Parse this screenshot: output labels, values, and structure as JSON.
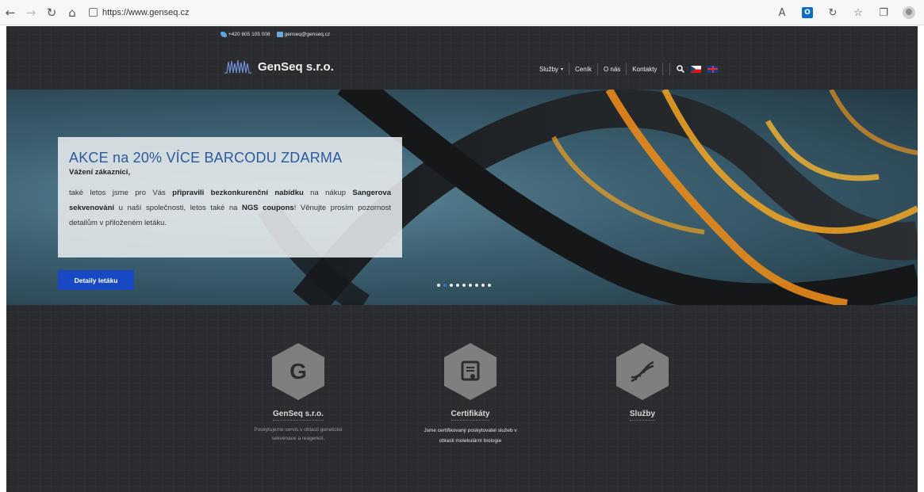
{
  "browser": {
    "url": "https://www.genseq.cz"
  },
  "topbar": {
    "phone": "+420 605 105 008",
    "email": "genseq@genseq.cz"
  },
  "header": {
    "logo_text": "GenSeq s.r.o.",
    "menu": [
      {
        "label": "Služby"
      },
      {
        "label": "Ceník"
      },
      {
        "label": "O nás"
      },
      {
        "label": "Kontakty"
      }
    ]
  },
  "hero": {
    "title": "AKCE na 20% VÍCE BARCODU ZDARMA",
    "greeting": "Vážení zákazníci,",
    "body_parts": [
      "také letos jsme pro Vás ",
      "připravili bezkonkurenční nabídku",
      " na nákup ",
      "Sangerova sekvenování",
      " u naší společnosti, letos také na ",
      "NGS coupons",
      "! Věnujte prosím pozornost detailům v přiloženém letáku."
    ],
    "cta_label": "Detaily letáku",
    "slides_total": 9,
    "slide_active": 2
  },
  "features": [
    {
      "title": "GenSeq s.r.o.",
      "text": "Poskytujeme servis v oblasti genetické sekvenace a reagencií.",
      "icon": "g-letter-icon"
    },
    {
      "title": "Certifikáty",
      "text": "Jsme certifikovaný poskytovatel služeb v oblasti molekulární biologie",
      "icon": "certificate-icon"
    },
    {
      "title": "Služby",
      "text": "",
      "icon": "dna-icon"
    }
  ]
}
